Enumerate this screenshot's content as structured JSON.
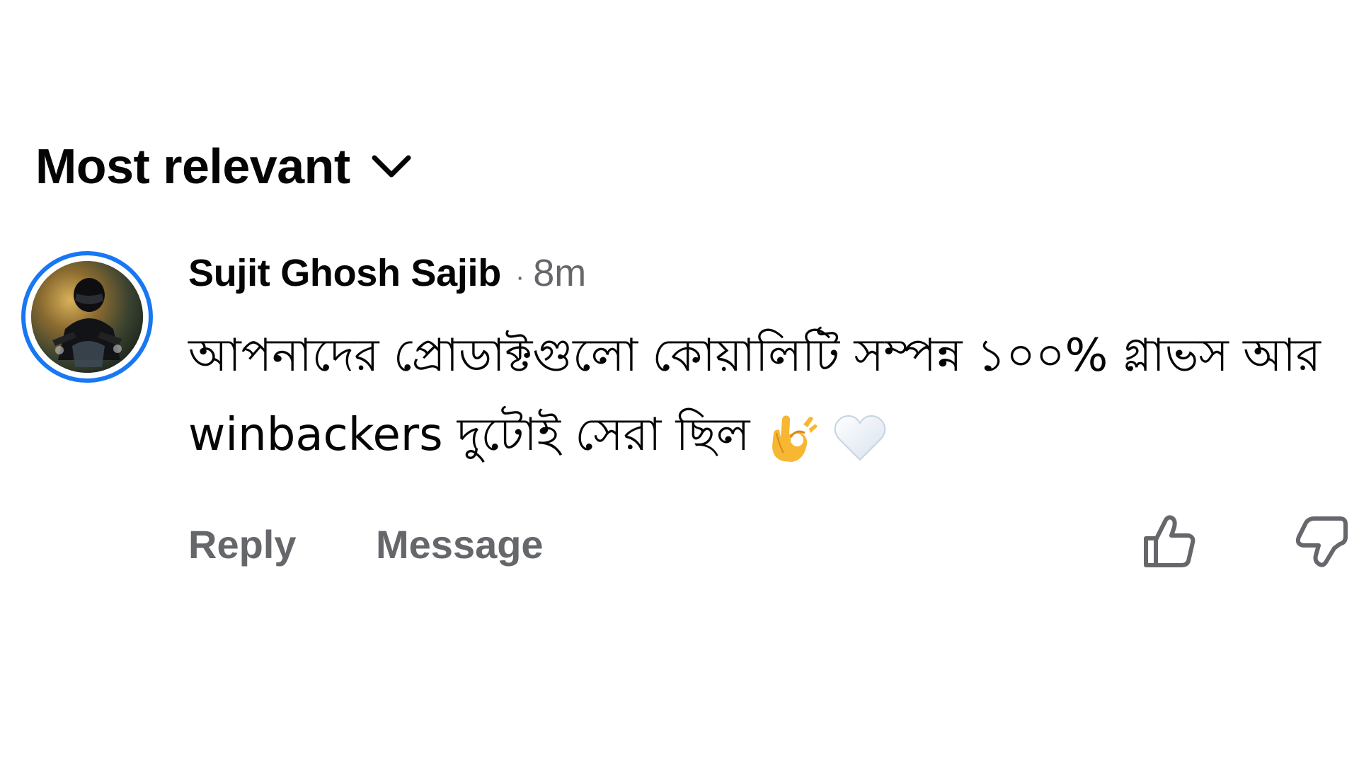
{
  "sort": {
    "label": "Most relevant",
    "chevron_icon": "chevron-down-icon"
  },
  "comment": {
    "author": "Sujit Ghosh Sajib",
    "separator": "·",
    "time": "8m",
    "text": "আপনাদের প্রোডাক্টগুলো কোয়ালিটি সম্পন্ন ১০০% গ্লাভস আর winbackers   দুটোই সেরা ছিল",
    "emojis": [
      "ok-hand-emoji",
      "white-heart-emoji"
    ],
    "avatar_ring_color": "#1877F2",
    "avatar_icon": "avatar-motorcyclist"
  },
  "actions": {
    "reply_label": "Reply",
    "message_label": "Message",
    "like_icon": "thumbs-up-icon",
    "dislike_icon": "thumbs-down-icon"
  },
  "colors": {
    "primary_text": "#050505",
    "secondary_text": "#65676B",
    "accent": "#1877F2"
  }
}
